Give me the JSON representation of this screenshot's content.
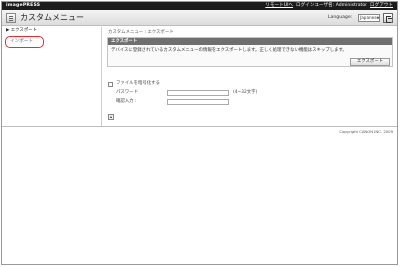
{
  "topbar": {
    "brand": "imagePRESS",
    "links": [
      "リモートUIへ",
      "ログインユーザ名: Administrator",
      "ログアウト"
    ]
  },
  "header": {
    "title": "カスタムメニュー",
    "language_label": "Language:",
    "language_value": "Japanese"
  },
  "sidebar": {
    "heading": "エクスポート",
    "items": [
      {
        "label": "インポート"
      }
    ]
  },
  "main": {
    "breadcrumb": "カスタムメニュー : エクスポート",
    "panel_title": "エクスポート",
    "description": "デバイスに登録されているカスタムメニューの情報をエクスポートします。正しく処理できない機能はスキップします。",
    "export_button": "エクスポート",
    "encrypt_label": "ファイルを暗号化する",
    "password_label": "パスワード",
    "password_hint": "(4~32文字)",
    "confirm_label": "確認入力 :"
  },
  "footer": {
    "copyright": "Copyright CANON INC. 2009"
  },
  "colors": {
    "topbar_bg": "#1c1c1c",
    "panel_head_bg": "#6f6f6f",
    "highlight_border": "#dd3333",
    "link_blue": "#2f5ea8"
  }
}
